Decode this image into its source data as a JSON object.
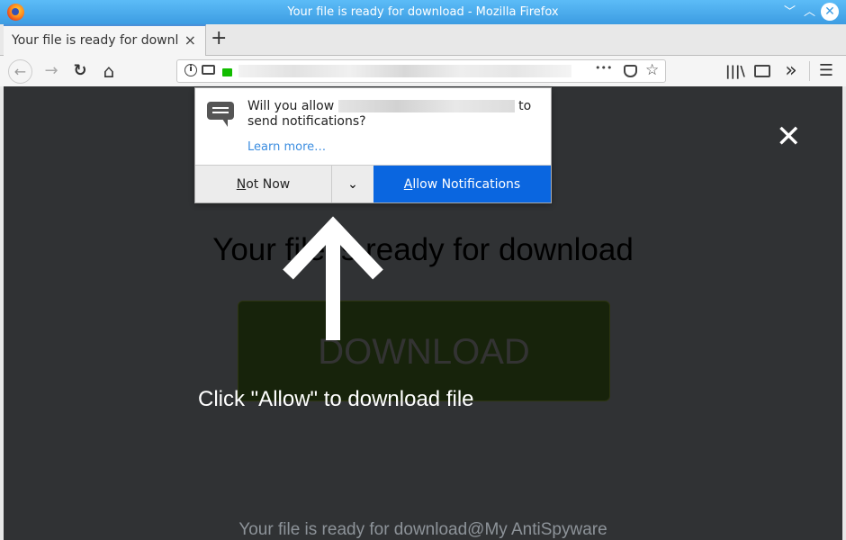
{
  "window": {
    "title": "Your file is ready for download - Mozilla Firefox"
  },
  "tab": {
    "label": "Your file is ready for downl",
    "close": "×",
    "new_tab": "+"
  },
  "nav": {
    "back": "←",
    "forward": "→",
    "reload": "↻",
    "home": "⌂",
    "more": "•••",
    "menu": "☰",
    "overflow": "»"
  },
  "popup": {
    "message_before": "Will you allow",
    "message_after": "to",
    "message_line2": "send notifications?",
    "learn_more": "Learn more…",
    "not_now_key": "N",
    "not_now_rest": "ot Now",
    "allow_key": "A",
    "allow_rest": "llow Notifications",
    "accent": "#0a66e0"
  },
  "page": {
    "heading": "Your file is ready for download",
    "download_button": "DOWNLOAD",
    "instruction": "Click \"Allow\" to download file",
    "footer": "Your file is ready for download@My AntiSpyware",
    "close": "✕"
  }
}
